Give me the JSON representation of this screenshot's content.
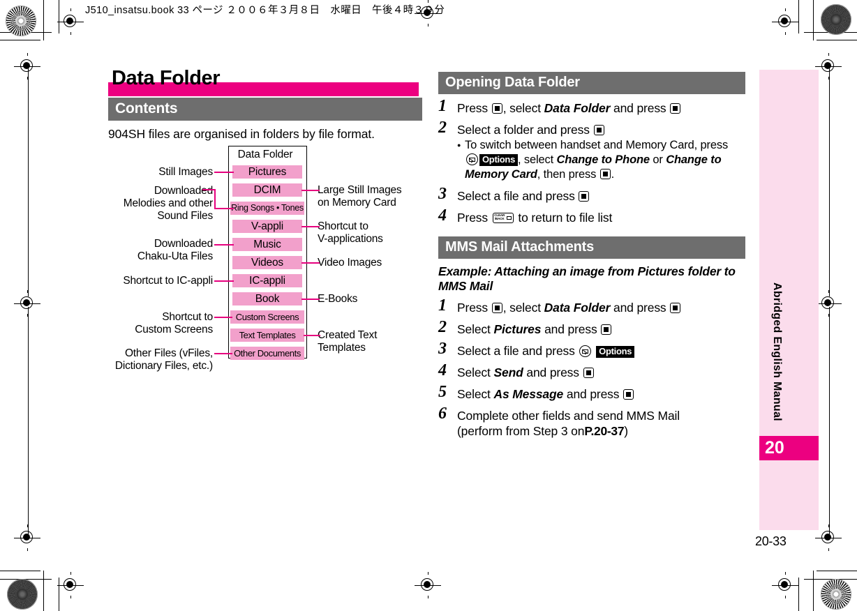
{
  "print_header": "J510_insatsu.book  33 ページ  ２００６年３月８日　水曜日　午後４時３９分",
  "chapter": {
    "title": "Data Folder"
  },
  "left": {
    "contents_header": "Contents",
    "lead": "904SH files are organised in folders by file format.",
    "diagram": {
      "box_title": "Data Folder",
      "folders": [
        "Pictures",
        "DCIM",
        "Ring Songs • Tones",
        "V-appli",
        "Music",
        "Videos",
        "IC-appli",
        "Book",
        "Custom Screens",
        "Text Templates",
        "Other Documents"
      ],
      "left_labels": [
        "Still Images",
        "Downloaded\nMelodies and other\nSound Files",
        "Downloaded\nChaku-Uta Files",
        "Shortcut to IC-appli",
        "Shortcut to\nCustom Screens",
        "Other Files (vFiles,\nDictionary Files, etc.)"
      ],
      "left_label_0": "Still Images",
      "left_label_1a": "Downloaded",
      "left_label_1b": "Melodies and other",
      "left_label_1c": "Sound Files",
      "left_label_2a": "Downloaded",
      "left_label_2b": "Chaku-Uta Files",
      "left_label_3": "Shortcut to IC-appli",
      "left_label_4a": "Shortcut to",
      "left_label_4b": "Custom Screens",
      "left_label_5a": "Other Files (vFiles,",
      "left_label_5b": "Dictionary Files, etc.)",
      "right_label_0a": "Large Still Images",
      "right_label_0b": "on Memory Card",
      "right_label_1a": "Shortcut to",
      "right_label_1b": "V-applications",
      "right_label_2": "Video Images",
      "right_label_3": "E-Books",
      "right_label_4a": "Created Text",
      "right_label_4b": "Templates"
    }
  },
  "right": {
    "opening_header": "Opening Data Folder",
    "opening_steps": {
      "s1_num": "1",
      "s1_a": "Press",
      "s1_b": ", select",
      "s1_c": "Data Folder",
      "s1_d": "and press",
      "s2_num": "2",
      "s2_a": "Select a folder and press",
      "s2_bullet_a": "To switch between handset and Memory Card, press",
      "s2_badge": "Options",
      "s2_bullet_b": ", select",
      "s2_bullet_c": "Change to Phone",
      "s2_bullet_d": "or",
      "s2_bullet_e": "Change to",
      "s2_bullet_f": "Memory Card",
      "s2_bullet_g": ", then press",
      "s2_bullet_h": ".",
      "s3_num": "3",
      "s3_a": "Select a file and press",
      "s4_num": "4",
      "s4_a": "Press",
      "s4_b": "to return to file list"
    },
    "mms_header": "MMS Mail Attachments",
    "mms_example_a": "Example: Attaching an image from Pictures folder",
    "mms_example_b": "to MMS Mail",
    "mms_steps": {
      "m1_num": "1",
      "m1_a": "Press",
      "m1_b": ", select",
      "m1_c": "Data Folder",
      "m1_d": "and press",
      "m2_num": "2",
      "m2_a": "Select",
      "m2_b": "Pictures",
      "m2_c": "and press",
      "m3_num": "3",
      "m3_a": "Select a file and press",
      "m3_badge": "Options",
      "m4_num": "4",
      "m4_a": "Select",
      "m4_b": "Send",
      "m4_c": "and press",
      "m5_num": "5",
      "m5_a": "Select",
      "m5_b": "As Message",
      "m5_c": "and press",
      "m6_num": "6",
      "m6_a": "Complete other fields and send MMS Mail",
      "m6_b": "(perform from Step 3 on",
      "m6_ref": "P.20-37",
      "m6_c": ")"
    }
  },
  "sidebar": {
    "vertical_label": "Abridged English Manual",
    "chapter_number": "20"
  },
  "footer": {
    "page_number": "20-33"
  },
  "keys": {
    "center_key": "center-select-key",
    "mail_key": "mail-key",
    "clear_key_line1": "CLEAR",
    "clear_key_line2": "/BACK"
  },
  "colors": {
    "magenta": "#EC0080",
    "pink_box": "#F2A0CB",
    "pink_tint": "#FBDCEC",
    "gray_header": "#6E6E6E"
  }
}
